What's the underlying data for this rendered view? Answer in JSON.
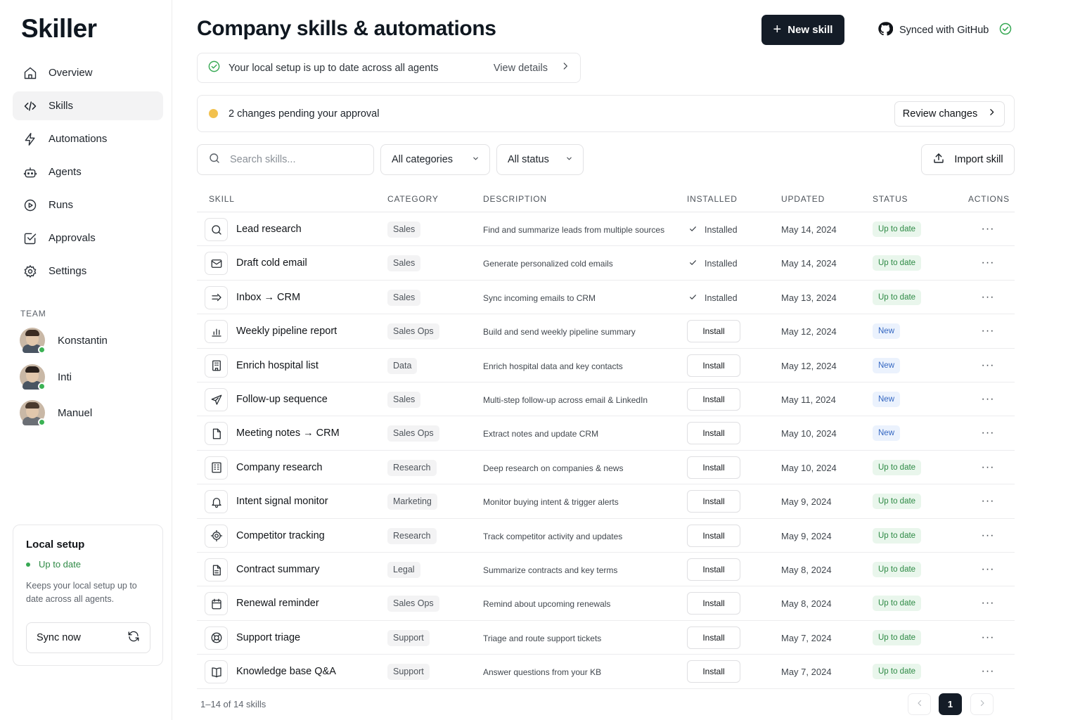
{
  "app": {
    "logo": "Skiller"
  },
  "sidebar": {
    "items": [
      {
        "label": "Overview",
        "icon": "home-icon"
      },
      {
        "label": "Skills",
        "icon": "code-icon",
        "active": true
      },
      {
        "label": "Automations",
        "icon": "lightning-icon"
      },
      {
        "label": "Agents",
        "icon": "robot-icon"
      },
      {
        "label": "Runs",
        "icon": "play-circle-icon"
      },
      {
        "label": "Approvals",
        "icon": "check-square-icon"
      },
      {
        "label": "Settings",
        "icon": "gear-icon"
      }
    ],
    "team_heading": "TEAM",
    "team": [
      {
        "name": "Konstantin",
        "online": true
      },
      {
        "name": "Inti",
        "online": true
      },
      {
        "name": "Manuel",
        "online": true
      }
    ],
    "local_setup": {
      "title": "Local setup",
      "status": "Up to date",
      "description": "Keeps your local setup up to date across all agents.",
      "sync_label": "Sync now"
    }
  },
  "header": {
    "title": "Company skills & automations",
    "new_skill_label": "New skill",
    "github_label": "Synced with GitHub"
  },
  "banner": {
    "message": "Your local setup is up to date across all agents",
    "view_details": "View details"
  },
  "pending": {
    "message": "2 changes pending your approval",
    "review_label": "Review changes"
  },
  "filters": {
    "search_placeholder": "Search skills...",
    "category": "All categories",
    "status": "All status",
    "import_label": "Import skill"
  },
  "table": {
    "columns": [
      "SKILL",
      "CATEGORY",
      "DESCRIPTION",
      "INSTALLED",
      "UPDATED",
      "STATUS",
      "ACTIONS"
    ],
    "installed_label": "Installed",
    "install_label": "Install",
    "actions_label": "···",
    "rows": [
      {
        "icon": "search-icon",
        "name": "Lead research",
        "category": "Sales",
        "description": "Find and summarize leads from multiple sources",
        "installed": true,
        "updated": "May 14, 2024",
        "status": "Up to date"
      },
      {
        "icon": "mail-icon",
        "name": "Draft cold email",
        "category": "Sales",
        "description": "Generate personalized cold emails",
        "installed": true,
        "updated": "May 14, 2024",
        "status": "Up to date"
      },
      {
        "icon": "arrow-right-icon",
        "name": "Inbox → CRM",
        "category": "Sales",
        "description": "Sync incoming emails to CRM",
        "installed": true,
        "updated": "May 13, 2024",
        "status": "Up to date"
      },
      {
        "icon": "bar-chart-icon",
        "name": "Weekly pipeline report",
        "category": "Sales Ops",
        "description": "Build and send weekly pipeline summary",
        "installed": false,
        "updated": "May 12, 2024",
        "status": "New"
      },
      {
        "icon": "building-icon",
        "name": "Enrich hospital list",
        "category": "Data",
        "description": "Enrich hospital data and key contacts",
        "installed": false,
        "updated": "May 12, 2024",
        "status": "New"
      },
      {
        "icon": "send-icon",
        "name": "Follow-up sequence",
        "category": "Sales",
        "description": "Multi-step follow-up across email & LinkedIn",
        "installed": false,
        "updated": "May 11, 2024",
        "status": "New"
      },
      {
        "icon": "file-icon",
        "name": "Meeting notes → CRM",
        "category": "Sales Ops",
        "description": "Extract notes and update CRM",
        "installed": false,
        "updated": "May 10, 2024",
        "status": "New"
      },
      {
        "icon": "office-building-icon",
        "name": "Company research",
        "category": "Research",
        "description": "Deep research on companies & news",
        "installed": false,
        "updated": "May 10, 2024",
        "status": "Up to date"
      },
      {
        "icon": "bell-icon",
        "name": "Intent signal monitor",
        "category": "Marketing",
        "description": "Monitor buying intent & trigger alerts",
        "installed": false,
        "updated": "May 9, 2024",
        "status": "Up to date"
      },
      {
        "icon": "target-icon",
        "name": "Competitor tracking",
        "category": "Research",
        "description": "Track competitor activity and updates",
        "installed": false,
        "updated": "May 9, 2024",
        "status": "Up to date"
      },
      {
        "icon": "document-icon",
        "name": "Contract summary",
        "category": "Legal",
        "description": "Summarize contracts and key terms",
        "installed": false,
        "updated": "May 8, 2024",
        "status": "Up to date"
      },
      {
        "icon": "calendar-icon",
        "name": "Renewal reminder",
        "category": "Sales Ops",
        "description": "Remind about upcoming renewals",
        "installed": false,
        "updated": "May 8, 2024",
        "status": "Up to date"
      },
      {
        "icon": "lifebuoy-icon",
        "name": "Support triage",
        "category": "Support",
        "description": "Triage and route support tickets",
        "installed": false,
        "updated": "May 7, 2024",
        "status": "Up to date"
      },
      {
        "icon": "book-icon",
        "name": "Knowledge base Q&A",
        "category": "Support",
        "description": "Answer questions from your KB",
        "installed": false,
        "updated": "May 7, 2024",
        "status": "Up to date"
      }
    ]
  },
  "footer": {
    "count": "1–14 of 14 skills",
    "current_page": "1"
  },
  "colors": {
    "primary": "#141c27",
    "success": "#2e8a45",
    "new_badge": "#3467c2",
    "pending": "#f2c14e"
  }
}
